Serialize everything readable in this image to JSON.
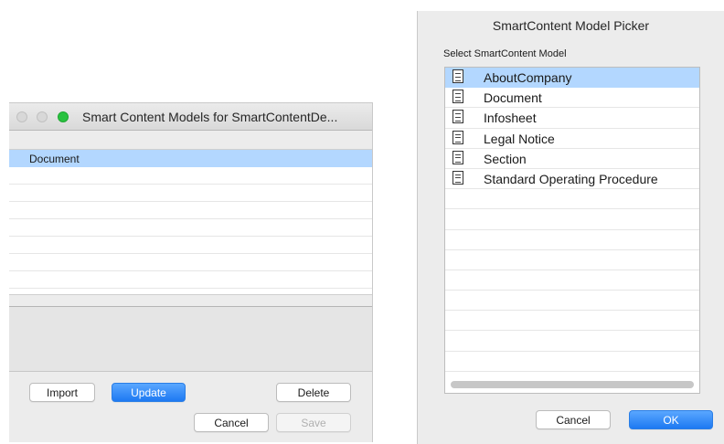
{
  "models_window": {
    "title": "Smart Content Models for SmartContentDe...",
    "rows": [
      "Document",
      "",
      "",
      "",
      "",
      "",
      "",
      ""
    ],
    "buttons": {
      "import": "Import",
      "update": "Update",
      "delete": "Delete",
      "cancel": "Cancel",
      "save": "Save"
    }
  },
  "picker_window": {
    "title": "SmartContent Model Picker",
    "prompt": "Select SmartContent Model",
    "items": [
      "AboutCompany",
      "Document",
      "Infosheet",
      "Legal Notice",
      "Section",
      "Standard Operating Procedure",
      "",
      "",
      "",
      "",
      "",
      "",
      "",
      "",
      "",
      ""
    ],
    "buttons": {
      "cancel": "Cancel",
      "ok": "OK"
    }
  },
  "colors": {
    "selection": "#b3d7ff",
    "primary_button": "#1d79f2",
    "zoom_light": "#29c240"
  },
  "icons": [
    "document-icon"
  ]
}
